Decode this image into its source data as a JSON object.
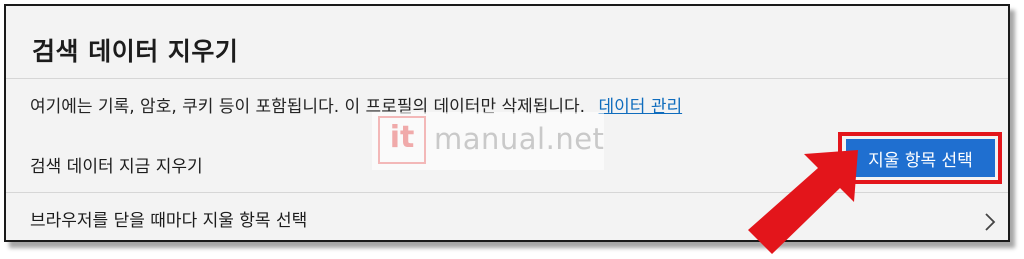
{
  "panel": {
    "title": "검색 데이터 지우기",
    "description": "여기에는 기록, 암호, 쿠키 등이 포함됩니다. 이 프로필의 데이터만 삭제됩니다.",
    "manage_link": "데이터 관리"
  },
  "rows": {
    "clear_now_label": "검색 데이터 지금 지우기",
    "clear_now_button": "지울 항목 선택",
    "on_close_label": "브라우저를 닫을 때마다 지울 항목 선택"
  },
  "watermark": {
    "logo": "it",
    "text": "manual.net"
  },
  "icons": {
    "chevron": "chevron-right-icon",
    "arrow": "red-arrow-icon"
  },
  "colors": {
    "primary_button": "#1f6fd0",
    "link": "#0f6cbd",
    "highlight": "#e3151b"
  }
}
